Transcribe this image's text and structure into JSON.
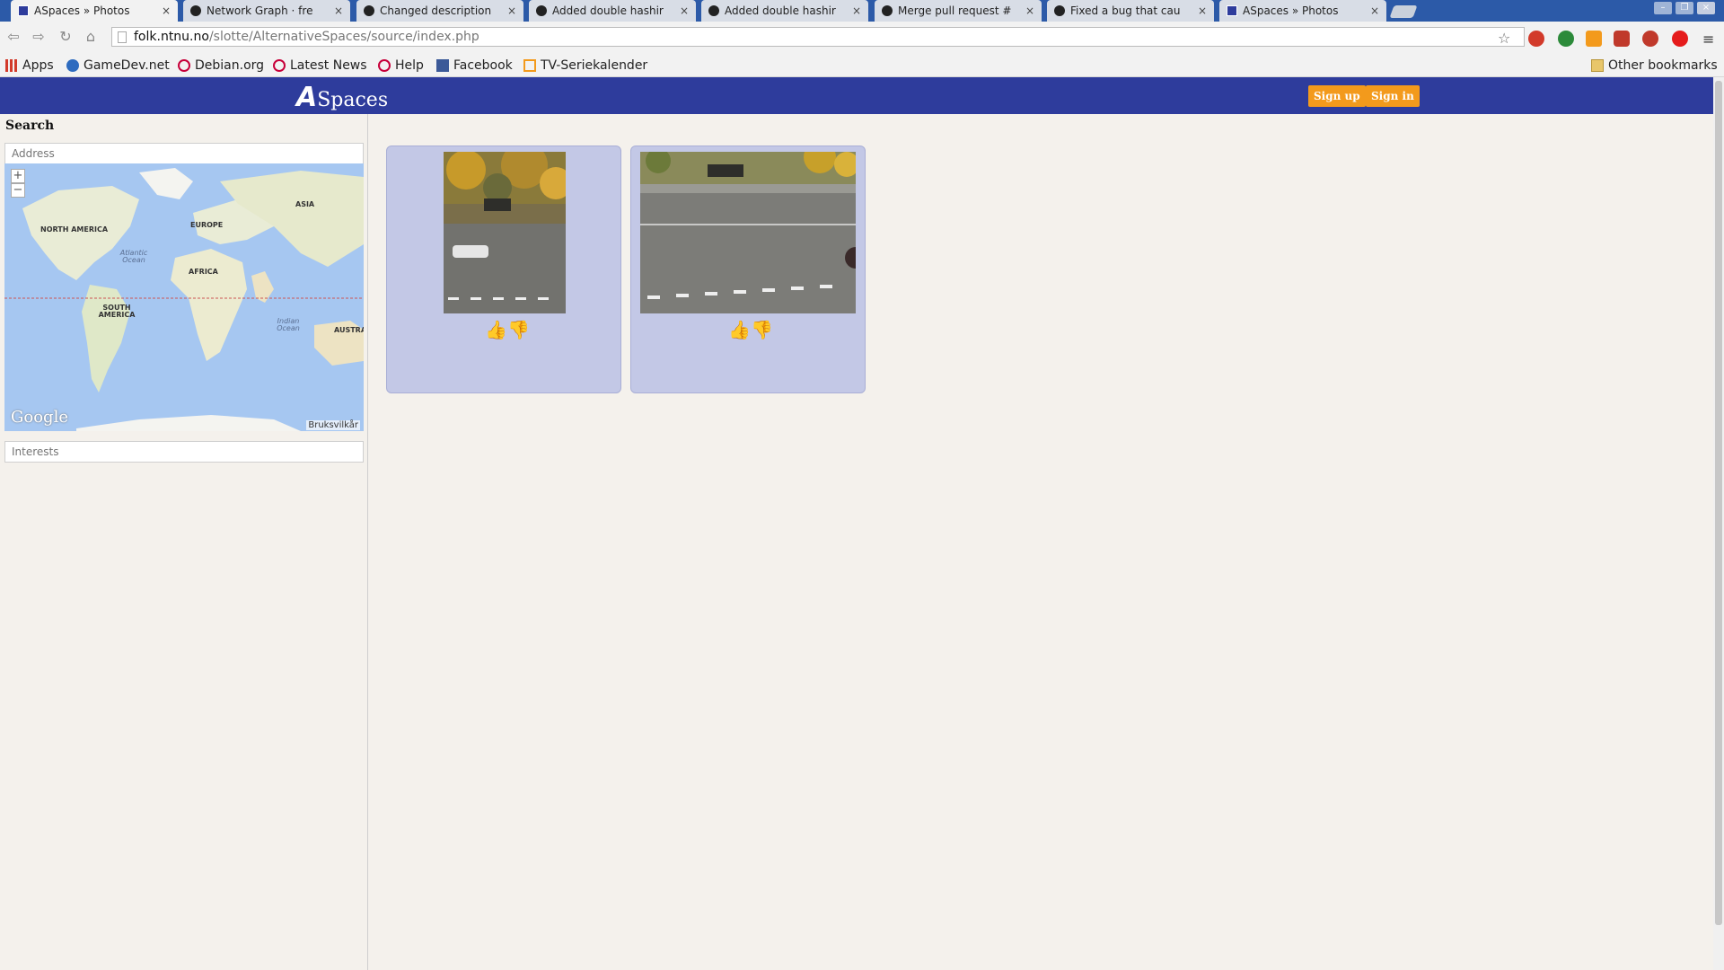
{
  "browser": {
    "tabs": [
      {
        "title": "ASpaces » Photos",
        "icon": "aspaces-favicon",
        "active": true
      },
      {
        "title": "Network Graph · fre",
        "icon": "github-icon",
        "active": false
      },
      {
        "title": "Changed description",
        "icon": "github-icon",
        "active": false
      },
      {
        "title": "Added double hashir",
        "icon": "github-icon",
        "active": false
      },
      {
        "title": "Added double hashir",
        "icon": "github-icon",
        "active": false
      },
      {
        "title": "Merge pull request #",
        "icon": "github-icon",
        "active": false
      },
      {
        "title": "Fixed a bug that cau",
        "icon": "github-icon",
        "active": false
      },
      {
        "title": "ASpaces » Photos",
        "icon": "aspaces-favicon",
        "active": false
      }
    ],
    "close_glyph": "×",
    "url_host": "folk.ntnu.no",
    "url_path": "/slotte/AlternativeSpaces/source/index.php",
    "bookmarks": [
      {
        "label": "Apps",
        "icon": "apps-grid-icon"
      },
      {
        "label": "GameDev.net",
        "icon": "gamedev-icon"
      },
      {
        "label": "Debian.org",
        "icon": "debian-icon"
      },
      {
        "label": "Latest News",
        "icon": "debian-icon"
      },
      {
        "label": "Help",
        "icon": "debian-icon"
      },
      {
        "label": "Facebook",
        "icon": "facebook-icon"
      },
      {
        "label": "TV-Seriekalender",
        "icon": "tv-icon"
      }
    ],
    "other_bookmarks": "Other bookmarks"
  },
  "site": {
    "logo_letter": "A",
    "logo_text": "Spaces",
    "signup_label": "Sign up",
    "signin_label": "Sign in",
    "brand_color": "#2e3c9c",
    "button_color": "#f39a1c"
  },
  "sidebar": {
    "heading": "Search",
    "address_placeholder": "Address",
    "interests_placeholder": "Interests",
    "map": {
      "zoom_in": "+",
      "zoom_out": "−",
      "labels": {
        "north_america": "NORTH AMERICA",
        "europe": "EUROPE",
        "asia": "ASIA",
        "africa": "AFRICA",
        "south_america": "SOUTH AMERICA",
        "australia": "AUSTRA",
        "atlantic": "Atlantic Ocean",
        "indian": "Indian Ocean"
      },
      "attribution": "Google",
      "terms": "Bruksvilkår"
    }
  },
  "photos": [
    {
      "subject": "street with bench, autumn trees and white car"
    },
    {
      "subject": "street with bench and dashed road line"
    }
  ]
}
